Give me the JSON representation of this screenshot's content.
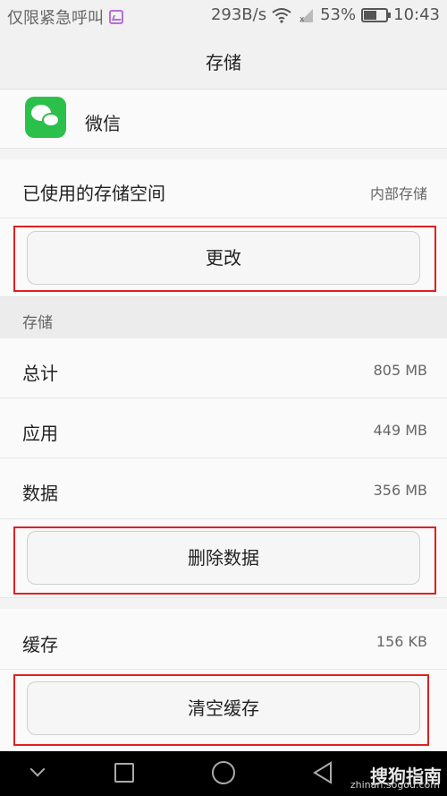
{
  "status_bar": {
    "carrier": "仅限紧急呼叫",
    "net_speed": "293B/s",
    "battery": "53%",
    "battery_level": 0.53,
    "time": "10:43"
  },
  "header": {
    "title": "存储"
  },
  "app": {
    "name": "微信",
    "icon": "wechat-icon",
    "icon_color": "#2bc04a"
  },
  "storage_used": {
    "label": "已使用的存储空间",
    "value": "内部存储"
  },
  "buttons": {
    "change": "更改",
    "delete_data": "删除数据",
    "clear_cache": "清空缓存"
  },
  "section": {
    "title": "存储"
  },
  "storage_rows": [
    {
      "label": "总计",
      "value": "805 MB"
    },
    {
      "label": "应用",
      "value": "449 MB"
    },
    {
      "label": "数据",
      "value": "356 MB"
    }
  ],
  "cache": {
    "label": "缓存",
    "value": "156 KB"
  },
  "nav_bar": {
    "icons": [
      "chevron-down-icon",
      "square-icon",
      "circle-icon",
      "triangle-back-icon"
    ]
  },
  "watermark": {
    "text": "搜狗指南",
    "url": "zhinan.sogou.com"
  },
  "colors": {
    "highlight": "#e02020",
    "accent": "#2bc04a"
  }
}
